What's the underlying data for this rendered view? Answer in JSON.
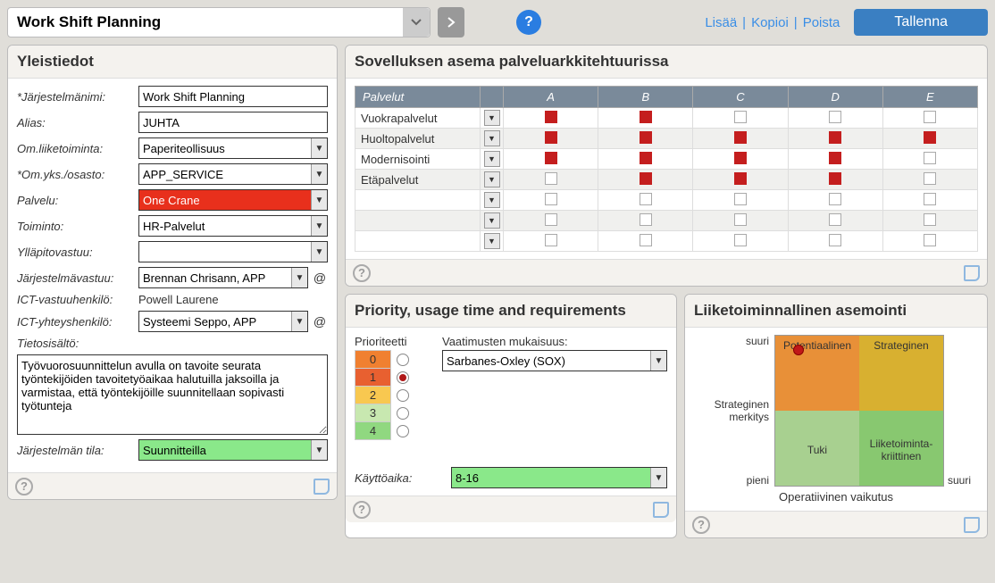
{
  "header": {
    "title": "Work Shift Planning",
    "links": [
      "Lisää",
      "Kopioi",
      "Poista"
    ],
    "save": "Tallenna"
  },
  "general": {
    "title": "Yleistiedot",
    "labels": {
      "system_name": "*Järjestelmänimi:",
      "alias": "Alias:",
      "business": "Om.liiketoiminta:",
      "unit": "*Om.yks./osasto:",
      "service": "Palvelu:",
      "function": "Toiminto:",
      "maintenance": "Ylläpitovastuu:",
      "sys_owner": "Järjestelmävastuu:",
      "ict_owner": "ICT-vastuuhenkilö:",
      "ict_contact": "ICT-yhteyshenkilö:",
      "content": "Tietosisältö:",
      "status": "Järjestelmän tila:"
    },
    "values": {
      "system_name": "Work Shift Planning",
      "alias": "JUHTA",
      "business": "Paperiteollisuus",
      "unit": "APP_SERVICE",
      "service": "One Crane",
      "function": "HR-Palvelut",
      "maintenance": "",
      "sys_owner": "Brennan Chrisann, APP",
      "ict_owner": "Powell Laurene",
      "ict_contact": "Systeemi Seppo, APP",
      "content": "Työvuorosuunnittelun avulla on tavoite seurata työntekijöiden tavoitetyöaikaa halutuilla jaksoilla ja varmistaa, että työntekijöille suunnitellaan sopivasti työtunteja",
      "status": "Suunnitteilla"
    }
  },
  "architecture": {
    "title": "Sovelluksen asema palveluarkkitehtuurissa",
    "col_header": "Palvelut",
    "cols": [
      "A",
      "B",
      "C",
      "D",
      "E"
    ],
    "rows": [
      {
        "name": "Vuokrapalvelut",
        "cells": [
          "red",
          "red",
          "box",
          "box",
          "box"
        ]
      },
      {
        "name": "Huoltopalvelut",
        "cells": [
          "red",
          "red",
          "red",
          "red",
          "red"
        ]
      },
      {
        "name": "Modernisointi",
        "cells": [
          "red",
          "red",
          "red",
          "red",
          "box"
        ]
      },
      {
        "name": "Etäpalvelut",
        "cells": [
          "box",
          "red",
          "red",
          "red",
          "box"
        ]
      },
      {
        "name": "",
        "cells": [
          "box",
          "box",
          "box",
          "box",
          "box"
        ]
      },
      {
        "name": "",
        "cells": [
          "box",
          "box",
          "box",
          "box",
          "box"
        ]
      },
      {
        "name": "",
        "cells": [
          "box",
          "box",
          "box",
          "box",
          "box"
        ]
      }
    ]
  },
  "priority": {
    "title": "Priority, usage time and requirements",
    "prio_label": "Prioriteetti",
    "levels": [
      "0",
      "1",
      "2",
      "3",
      "4"
    ],
    "selected": 1,
    "compliance_label": "Vaatimusten mukaisuus:",
    "compliance_value": "Sarbanes-Oxley (SOX)",
    "usage_label": "Käyttöaika:",
    "usage_value": "8-16"
  },
  "positioning": {
    "title": "Liiketoiminnallinen asemointi",
    "y_axis": "Strateginen merkitys",
    "y_high": "suuri",
    "y_low": "pieni",
    "x_high": "suuri",
    "x_axis": "Operatiivinen vaikutus",
    "quads": {
      "tl": "Potentiaalinen",
      "tr": "Strateginen",
      "bl": "Tuki",
      "br": "Liiketoiminta-kriittinen"
    }
  }
}
